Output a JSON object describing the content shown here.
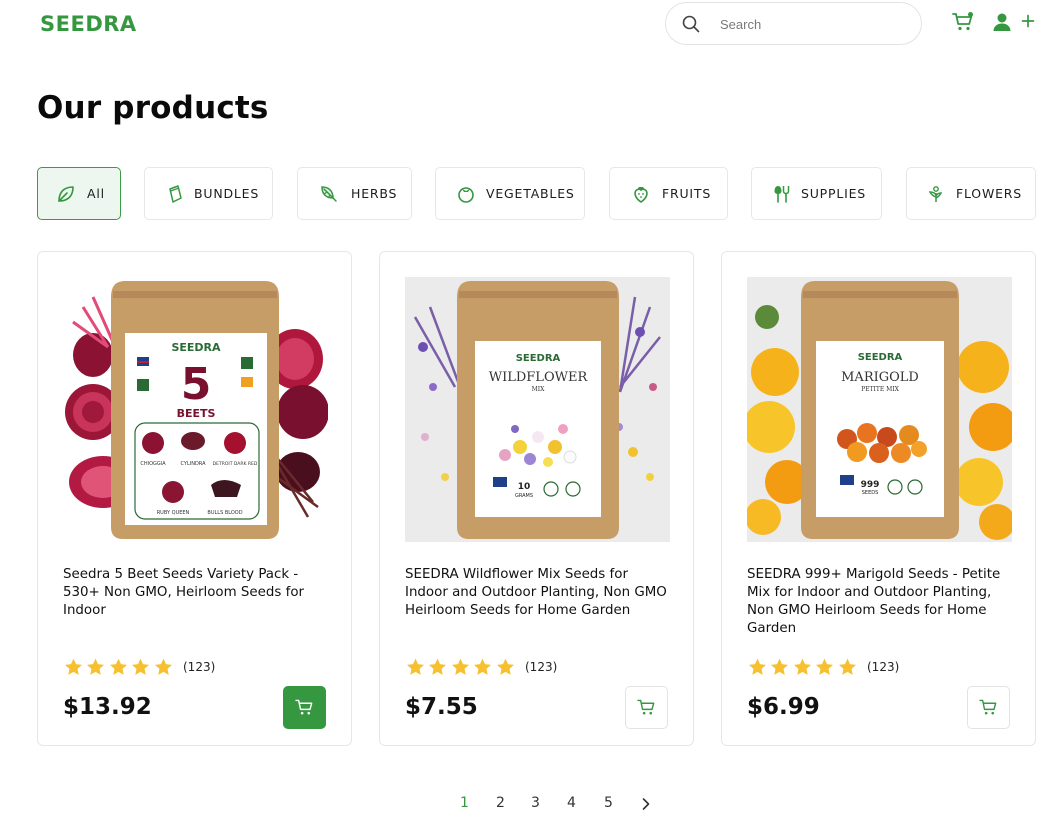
{
  "header": {
    "logo": "SEEDRA",
    "search_placeholder": "Search",
    "icons": [
      "search-icon",
      "cart-icon",
      "user-icon",
      "plus-icon"
    ]
  },
  "main": {
    "title": "Our products",
    "categories": [
      {
        "label": "All",
        "icon": "leaf-icon",
        "active": true
      },
      {
        "label": "BUNDLES",
        "icon": "seed-packet-icon",
        "active": false
      },
      {
        "label": "HERBS",
        "icon": "herb-icon",
        "active": false
      },
      {
        "label": "VEGETABLES",
        "icon": "tomato-icon",
        "active": false
      },
      {
        "label": "FRUITS",
        "icon": "strawberry-icon",
        "active": false
      },
      {
        "label": "SUPPLIES",
        "icon": "garden-tools-icon",
        "active": false
      },
      {
        "label": "FLOWERS",
        "icon": "flower-icon",
        "active": false
      }
    ],
    "products": [
      {
        "name": "Seedra 5 Beet Seeds Variety Pack - 530+ Non GMO, Heirloom Seeds for Indoor",
        "rating": 5,
        "reviews": "(123)",
        "price": "$13.92",
        "cart_button_filled": true,
        "packet": {
          "brand": "SEEDRA",
          "big": "5",
          "line1": "BEETS",
          "line2": "",
          "varieties": [
            "CHIOGGIA",
            "CYLINDRA",
            "DETROIT DARK RED",
            "RUBY QUEEN",
            "BULLS BLOOD"
          ],
          "badges": [
            "MADE IN USA",
            "NON GMO",
            "HEIRLOOM SEEDS"
          ]
        }
      },
      {
        "name": "SEEDRA Wildflower Mix Seeds for Indoor and Outdoor Planting, Non GMO Heirloom Seeds for Home Garden",
        "rating": 5,
        "reviews": "(123)",
        "price": "$7.55",
        "cart_button_filled": false,
        "packet": {
          "brand": "SEEDRA",
          "big": "",
          "line1": "WILDFLOWER",
          "line2": "MIX",
          "count": "10",
          "count_unit": "GRAMS",
          "badges": [
            "MADE IN USA"
          ]
        }
      },
      {
        "name": "SEEDRA 999+ Marigold Seeds - Petite Mix for Indoor and Outdoor Planting, Non GMO Heirloom Seeds for Home Garden",
        "rating": 5,
        "reviews": "(123)",
        "price": "$6.99",
        "cart_button_filled": false,
        "packet": {
          "brand": "SEEDRA",
          "big": "",
          "line1": "MARIGOLD",
          "line2": "PETITE MIX",
          "count": "999",
          "count_unit": "SEEDS",
          "badges": [
            "MADE IN USA"
          ]
        }
      }
    ]
  },
  "pagination": {
    "pages": [
      "1",
      "2",
      "3",
      "4",
      "5"
    ],
    "current": "1",
    "next_icon": "chevron-right-icon"
  },
  "colors": {
    "brand_green": "#359740",
    "active_tab_bg": "#eef7ef",
    "star": "#f7c02e",
    "border": "#e7e7e7"
  }
}
